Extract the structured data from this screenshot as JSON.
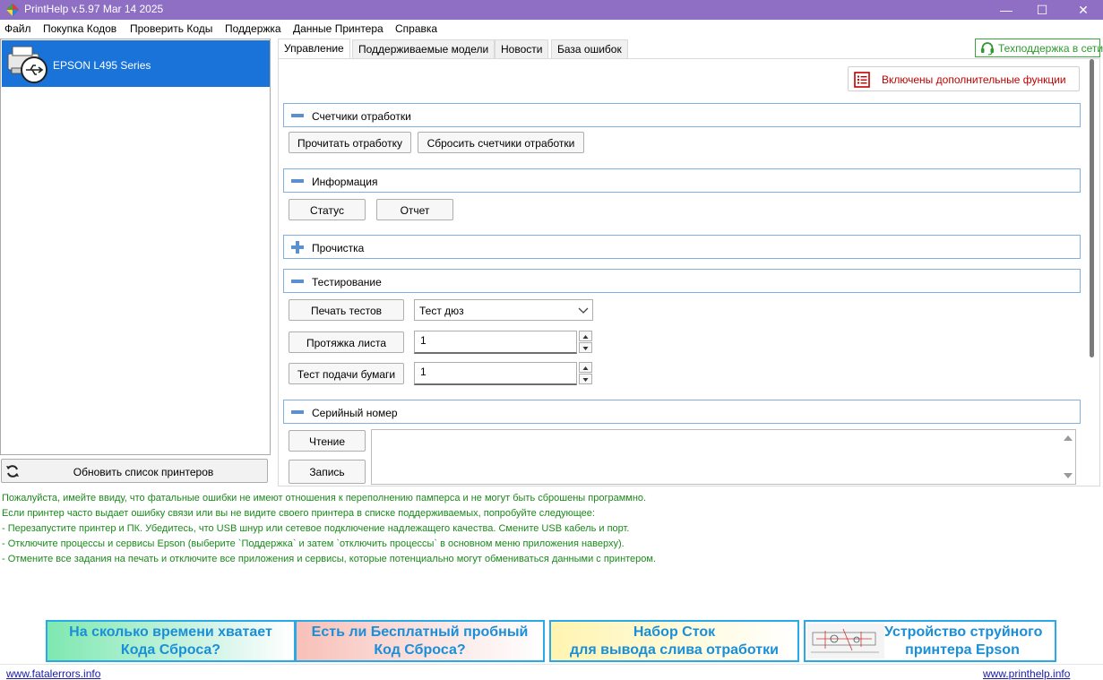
{
  "window": {
    "title": "PrintHelp v.5.97 Mar 14 2025",
    "minimize_glyph": "—",
    "maximize_glyph": "☐",
    "close_glyph": "✕"
  },
  "menu": [
    "Файл",
    "Покупка Кодов",
    "Проверить Коды",
    "Поддержка",
    "Данные Принтера",
    "Справка"
  ],
  "printers": [
    {
      "name": "EPSON L495 Series",
      "icon": "usb-printer-icon",
      "selected": true
    }
  ],
  "refresh_button": "Обновить список принтеров",
  "tabs": [
    {
      "label": "Управление",
      "active": true
    },
    {
      "label": "Поддерживаемые модели",
      "active": false
    },
    {
      "label": "Новости",
      "active": false
    },
    {
      "label": "База ошибок",
      "active": false
    }
  ],
  "support_button": "Техподдержка в сети",
  "advanced_button": "Включены дополнительные функции",
  "sections": {
    "counters": {
      "title": "Счетчики отработки",
      "expanded": true,
      "buttons": [
        "Прочитать отработку",
        "Сбросить счетчики отработки"
      ]
    },
    "info": {
      "title": "Информация",
      "expanded": true,
      "buttons": [
        "Статус",
        "Отчет"
      ]
    },
    "cleaning": {
      "title": "Прочистка",
      "expanded": false
    },
    "testing": {
      "title": "Тестирование",
      "expanded": true,
      "print_tests_button": "Печать тестов",
      "test_select_value": "Тест дюз",
      "sheet_feed_button": "Протяжка листа",
      "sheet_feed_value": "1",
      "paper_feed_button": "Тест подачи бумаги",
      "paper_feed_value": "1"
    },
    "serial": {
      "title": "Серийный номер",
      "expanded": true,
      "read_button": "Чтение",
      "write_button": "Запись",
      "text_value": ""
    }
  },
  "messages": [
    "Пожалуйста, имейте ввиду, что фатальные ошибки не имеют отношения к переполнению памперса и не могут быть сброшены программно.",
    "Если принтер часто выдает ошибку связи или вы не видите своего принтера в списке поддерживаемых, попробуйте следующее:",
    "- Перезапустите принтер и ПК. Убедитесь, что USB шнур или сетевое подключение надлежащего качества. Смените USB кабель и порт.",
    "- Отключите процессы и сервисы Epson (выберите `Поддержка` и затем `отключить процессы` в основном меню приложения наверху).",
    "- Отмените все задания на печать и отключите все приложения и сервисы, которые потенциально могут обмениваться данными с принтером."
  ],
  "message_color": "#1a8a1a",
  "banners": [
    {
      "line1": "На сколько времени хватает",
      "line2": "Кода Сброса?",
      "bg": "gradient-green"
    },
    {
      "line1": "Есть ли Бесплатный пробный",
      "line2": "Код Сброса?",
      "bg": "gradient-pink"
    },
    {
      "line1": "Набор Сток",
      "line2": "для вывода слива отработки",
      "bg": "gradient-yellow"
    },
    {
      "line1": "Устройство струйного",
      "line2": "принтера Epson",
      "bg": "diagram"
    }
  ],
  "footer": {
    "left_link": "www.fatalerrors.info",
    "right_link": "www.printhelp.info"
  },
  "colors": {
    "titlebar": "#8f6fc4",
    "selection": "#1a73d9",
    "section_border": "#7fb0e0",
    "banner_text": "#1a8fd8",
    "advanced_text": "#c00000",
    "support_green": "#2e9a2e"
  }
}
